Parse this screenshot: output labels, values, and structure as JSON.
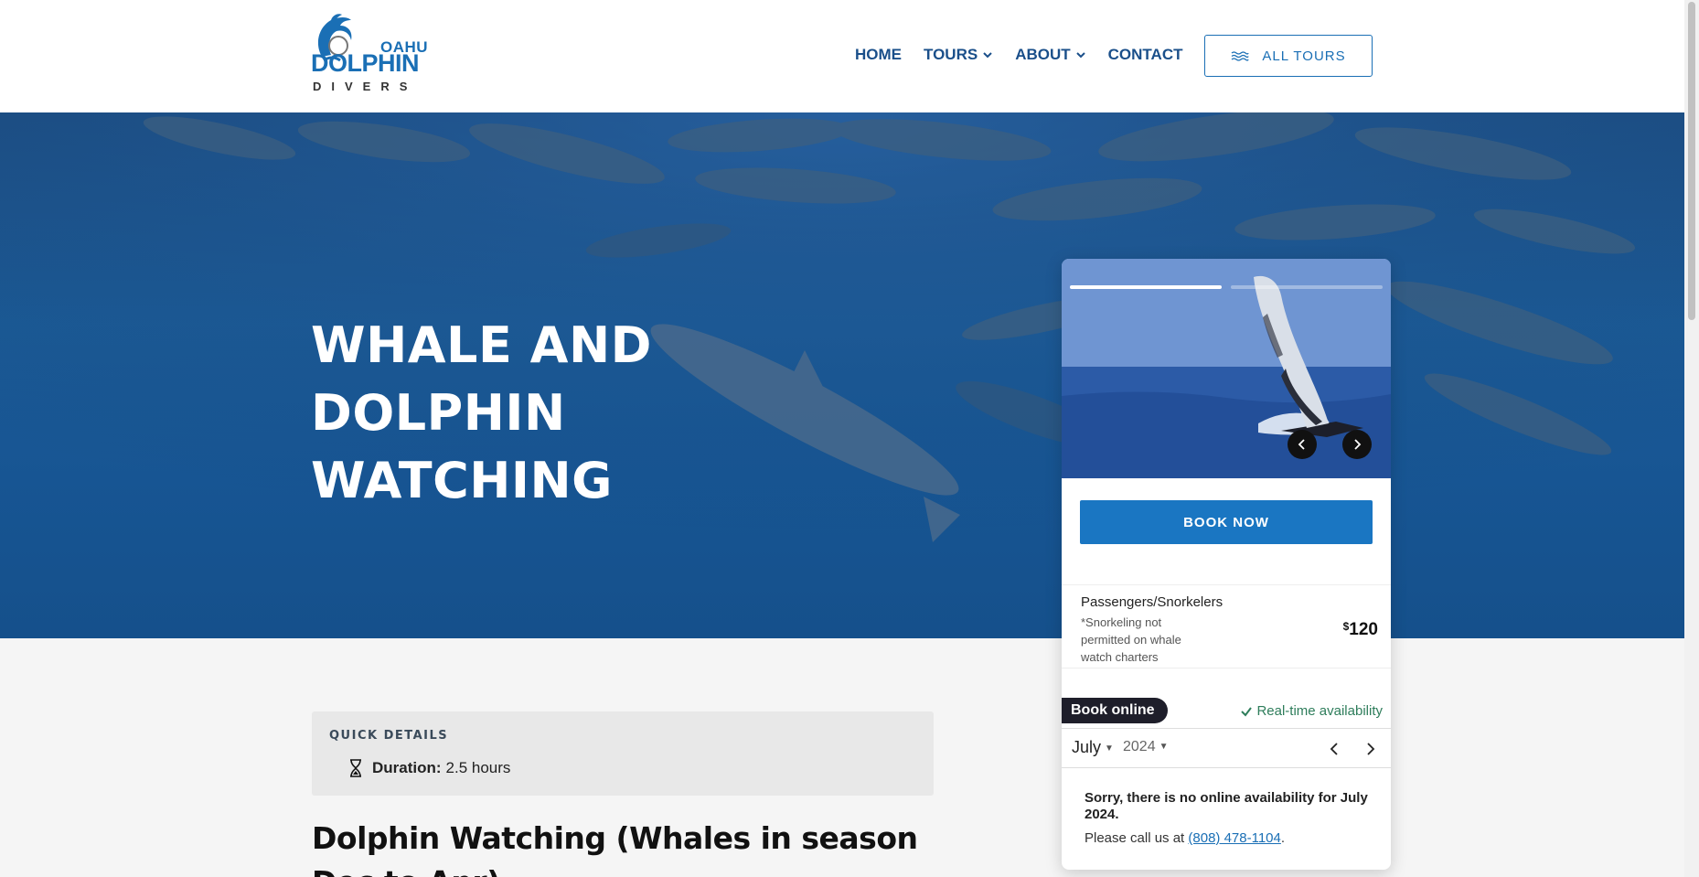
{
  "header": {
    "logo": {
      "line1": "OAHU",
      "line2": "DOLPHIN",
      "line3": "DIVERS"
    },
    "nav": [
      {
        "label": "HOME",
        "dropdown": false
      },
      {
        "label": "TOURS",
        "dropdown": true
      },
      {
        "label": "ABOUT",
        "dropdown": true
      },
      {
        "label": "CONTACT",
        "dropdown": false
      }
    ],
    "all_tours_label": "ALL TOURS",
    "all_tours_icon": "waves-icon"
  },
  "hero": {
    "title": "WHALE AND DOLPHIN WATCHING"
  },
  "booking": {
    "book_now_label": "BOOK NOW",
    "price_label": "Passengers/Snorkelers",
    "price_note": "*Snorkeling not permitted on whale watch charters",
    "price_currency": "$",
    "price_value": "120",
    "book_online_label": "Book online",
    "realtime_label": "Real-time availability",
    "month": "July",
    "year": "2024",
    "no_availability": "Sorry, there is no online availability for July 2024.",
    "call_prefix": "Please call us at ",
    "phone": "(808) 478-1104",
    "call_suffix": ".",
    "slides_progress": 0.5
  },
  "content": {
    "quick_title": "QUICK DETAILS",
    "duration_label": "Duration:",
    "duration_value": "2.5 hours",
    "heading": "Dolphin Watching (Whales in season Dec to Apr)"
  },
  "colors": {
    "brand_blue": "#1a6fb5",
    "nav_blue": "#1a4f8a",
    "book_button": "#1a76c2",
    "availability_green": "#2e7d5b"
  }
}
